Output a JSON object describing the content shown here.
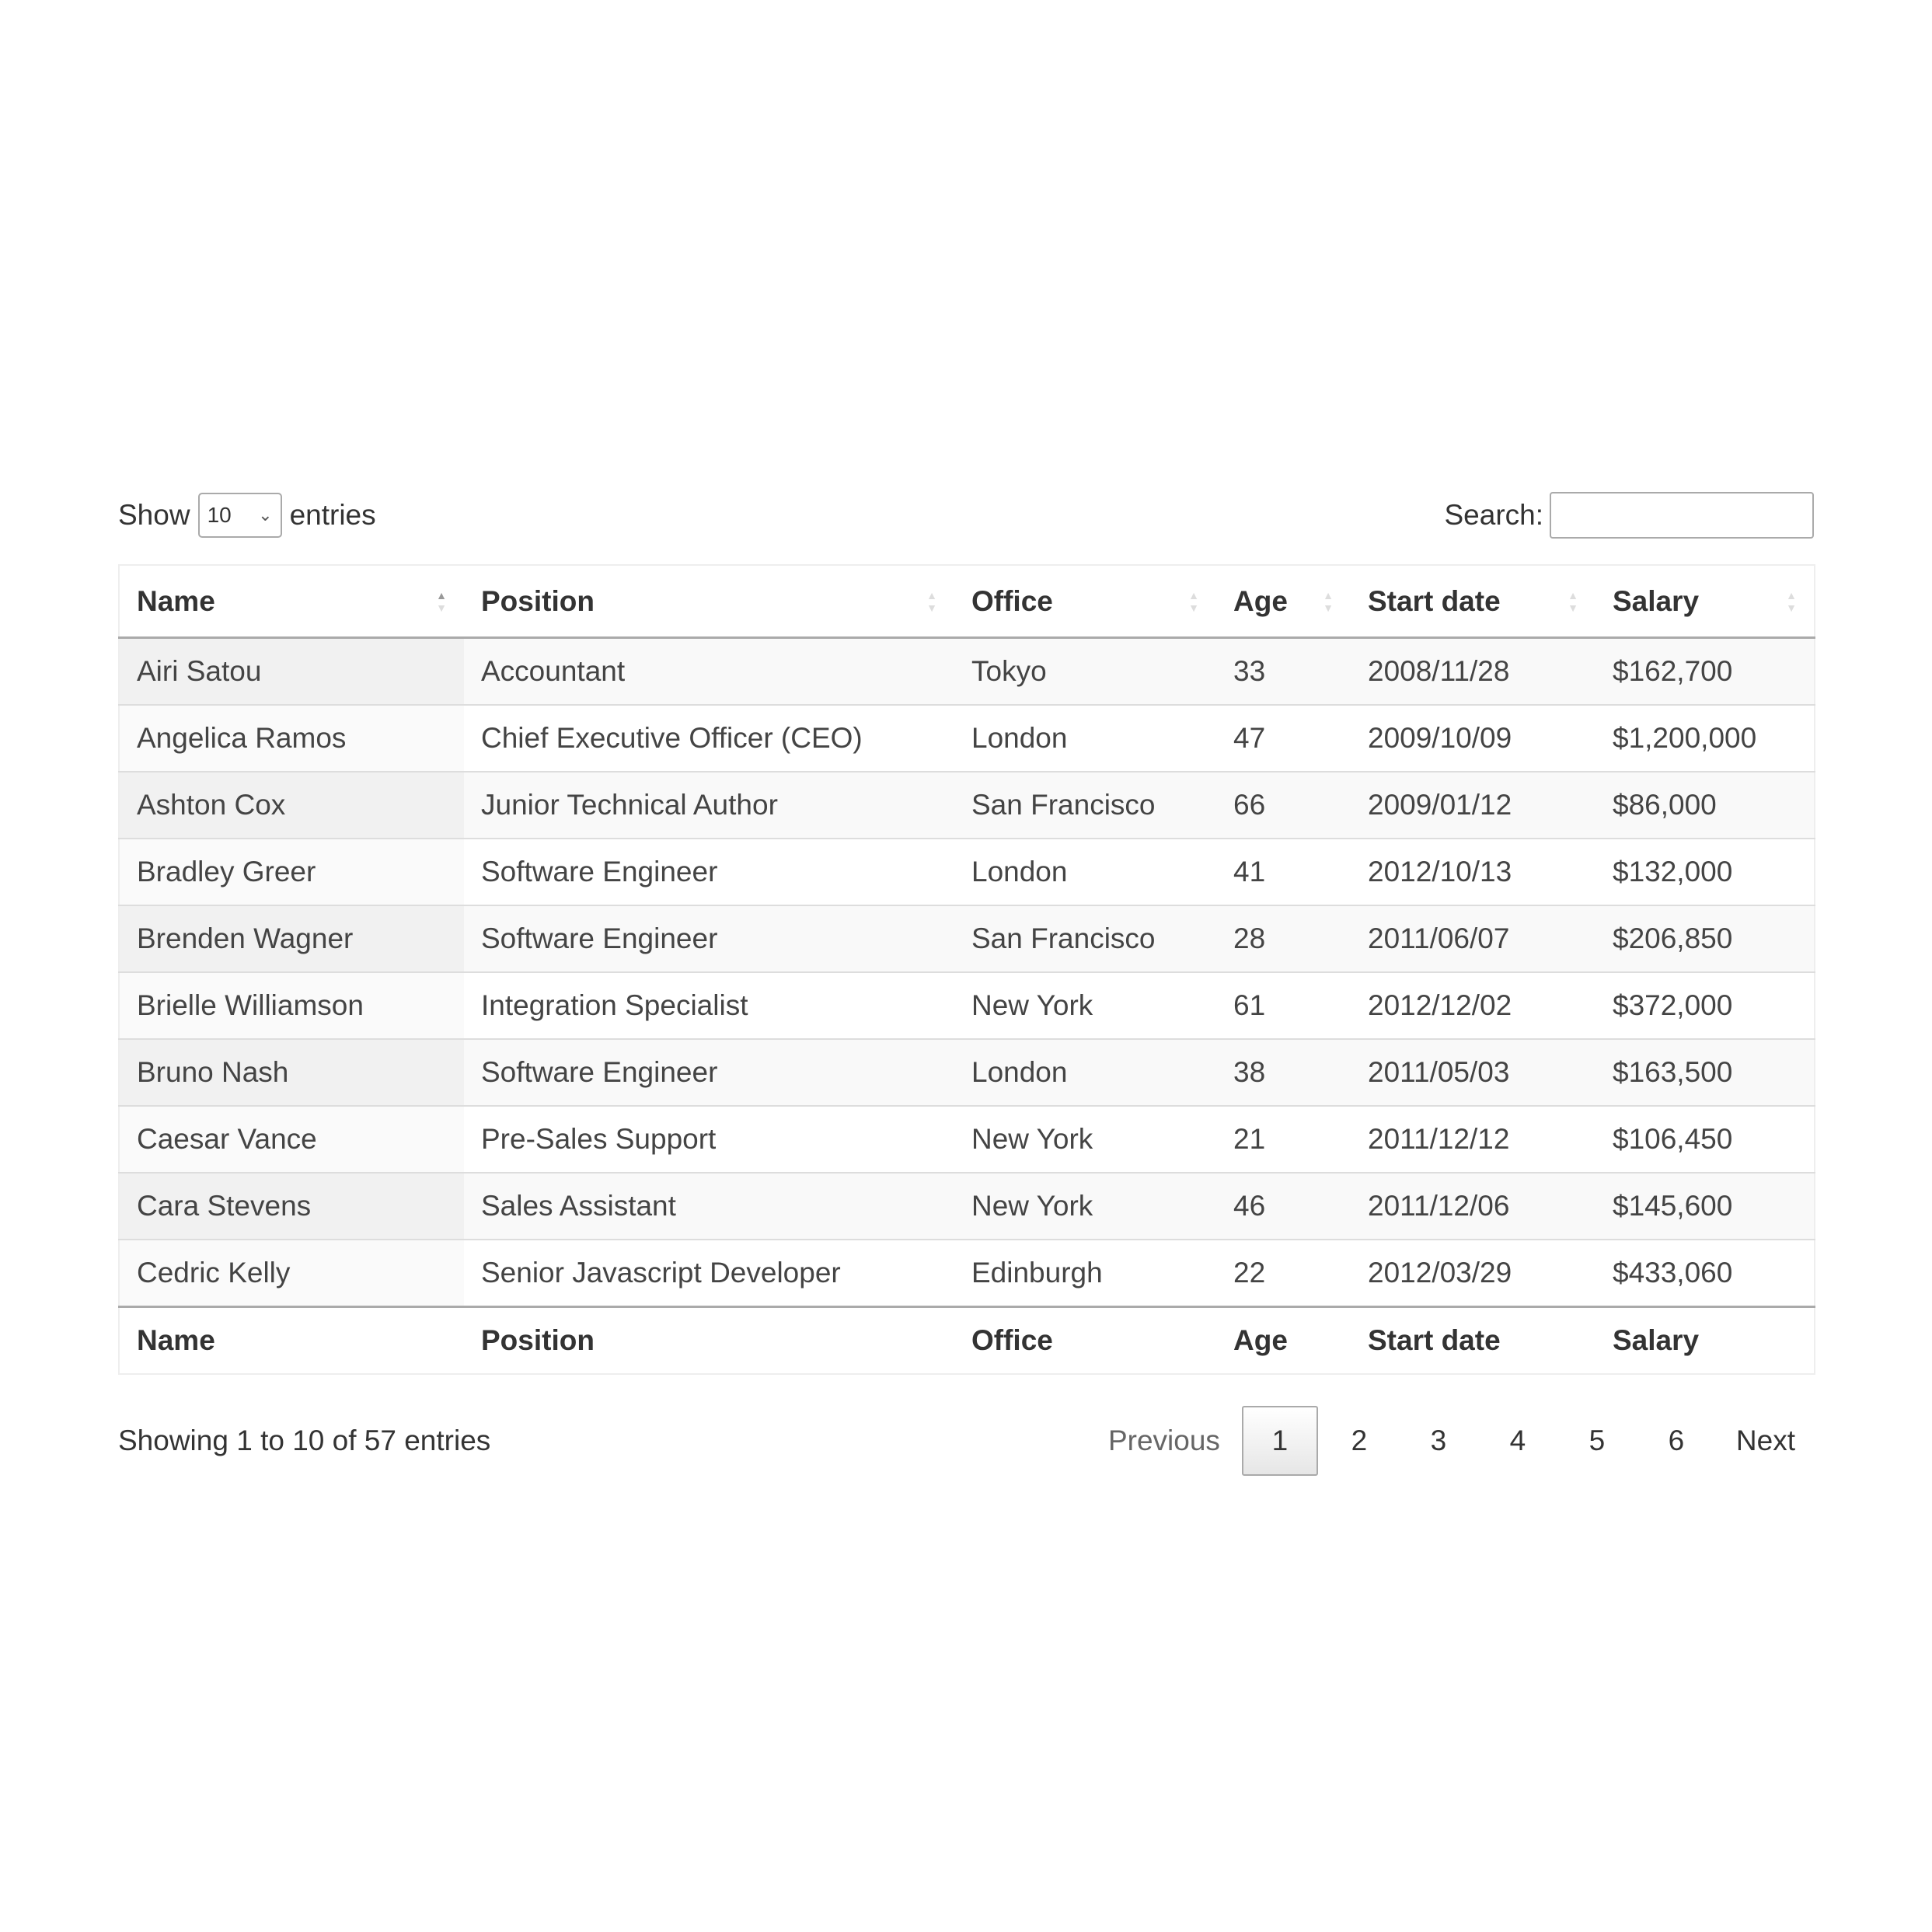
{
  "length_menu": {
    "show_label": "Show",
    "selected": "10",
    "entries_label": "entries"
  },
  "search": {
    "label": "Search:",
    "value": "",
    "placeholder": ""
  },
  "columns": [
    "Name",
    "Position",
    "Office",
    "Age",
    "Start date",
    "Salary"
  ],
  "sort": {
    "column": "Name",
    "direction": "ascending"
  },
  "rows": [
    [
      "Airi Satou",
      "Accountant",
      "Tokyo",
      "33",
      "2008/11/28",
      "$162,700"
    ],
    [
      "Angelica Ramos",
      "Chief Executive Officer (CEO)",
      "London",
      "47",
      "2009/10/09",
      "$1,200,000"
    ],
    [
      "Ashton Cox",
      "Junior Technical Author",
      "San Francisco",
      "66",
      "2009/01/12",
      "$86,000"
    ],
    [
      "Bradley Greer",
      "Software Engineer",
      "London",
      "41",
      "2012/10/13",
      "$132,000"
    ],
    [
      "Brenden Wagner",
      "Software Engineer",
      "San Francisco",
      "28",
      "2011/06/07",
      "$206,850"
    ],
    [
      "Brielle Williamson",
      "Integration Specialist",
      "New York",
      "61",
      "2012/12/02",
      "$372,000"
    ],
    [
      "Bruno Nash",
      "Software Engineer",
      "London",
      "38",
      "2011/05/03",
      "$163,500"
    ],
    [
      "Caesar Vance",
      "Pre-Sales Support",
      "New York",
      "21",
      "2011/12/12",
      "$106,450"
    ],
    [
      "Cara Stevens",
      "Sales Assistant",
      "New York",
      "46",
      "2011/12/06",
      "$145,600"
    ],
    [
      "Cedric Kelly",
      "Senior Javascript Developer",
      "Edinburgh",
      "22",
      "2012/03/29",
      "$433,060"
    ]
  ],
  "info": "Showing 1 to 10 of 57 entries",
  "pagination": {
    "previous": "Previous",
    "pages": [
      "1",
      "2",
      "3",
      "4",
      "5",
      "6"
    ],
    "current": "1",
    "next": "Next"
  }
}
